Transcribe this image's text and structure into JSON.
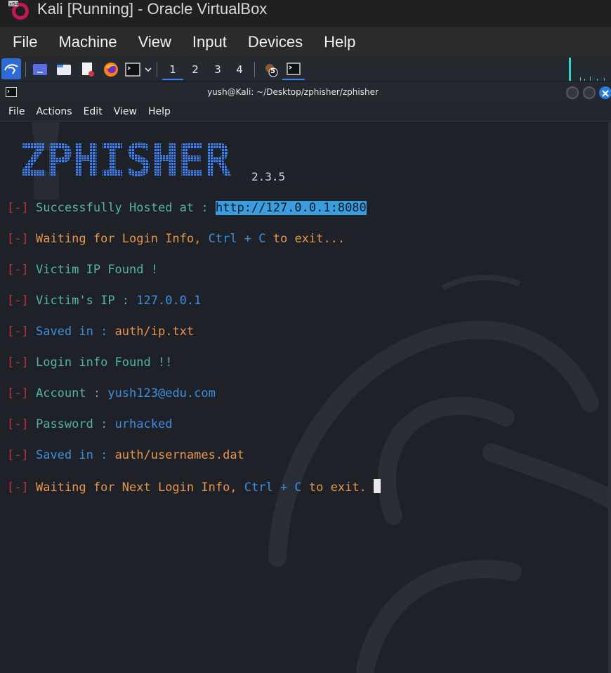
{
  "host": {
    "title": "Kali [Running] - Oracle VirtualBox",
    "menu": [
      "File",
      "Machine",
      "View",
      "Input",
      "Devices",
      "Help"
    ]
  },
  "panel": {
    "workspaces": [
      "1",
      "2",
      "3",
      "4"
    ],
    "badge": "5",
    "launcher_icons": [
      "kali-menu-icon",
      "desktop-icon",
      "file-manager-icon",
      "text-editor-icon",
      "firefox-icon",
      "terminal-icon"
    ]
  },
  "terminal": {
    "title": "yush@Kali: ~/Desktop/zphisher/zphisher",
    "menu": [
      "File",
      "Actions",
      "Edit",
      "View",
      "Help"
    ],
    "banner": "ZPHISHER",
    "version": "2.3.5",
    "bracket": "[-]",
    "lines": {
      "l1a": "Successfully Hosted at : ",
      "l1b": "http://127.0.0.1:8080",
      "l2a": "Waiting for Login Info, ",
      "l2b": "Ctrl + C",
      "l2c": " to exit...",
      "l3": "Victim IP Found !",
      "l4a": "Victim's IP : ",
      "l4b": "127.0.0.1",
      "l5a": "Saved in : ",
      "l5b": "auth/ip.txt",
      "l6": "Login info Found !!",
      "l7a": "Account : ",
      "l7b": "yush123@edu.com",
      "l8a": "Password : ",
      "l8b": "urhacked",
      "l9a": "Saved in : ",
      "l9b": "auth/usernames.dat",
      "l10a": "Waiting for Next Login Info, ",
      "l10b": "Ctrl + C",
      "l10c": " to exit. "
    }
  },
  "colors": {
    "bracket": "#c0333c",
    "cyan": "#54b3a4",
    "orange": "#e9964a",
    "blue": "#3f8fe0",
    "selection": "#3b9cde",
    "banner": "#3b82f6"
  }
}
